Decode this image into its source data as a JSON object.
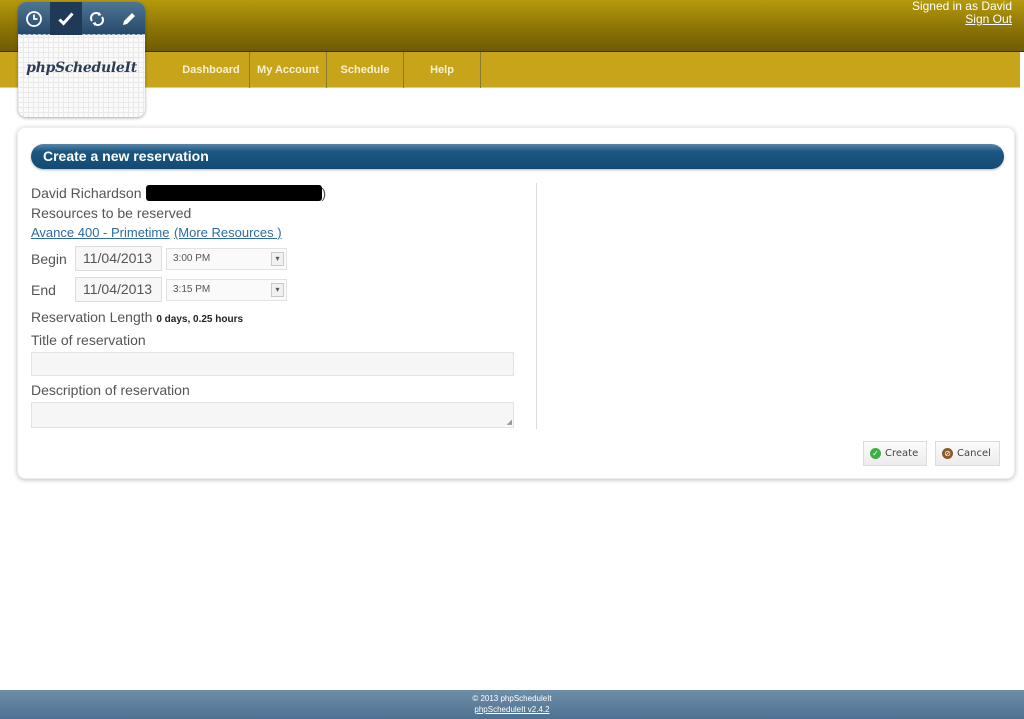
{
  "header": {
    "signed_in_text": "Signed in as David",
    "sign_out_label": "Sign Out"
  },
  "logo": {
    "text": "phpScheduleIt",
    "icons": [
      {
        "name": "clock-icon",
        "glyph": "◷"
      },
      {
        "name": "checkmark-icon",
        "glyph": "✔"
      },
      {
        "name": "refresh-icon",
        "glyph": "⟳"
      },
      {
        "name": "pencil-icon",
        "glyph": "✎"
      }
    ]
  },
  "nav": {
    "items": [
      {
        "label": "Dashboard"
      },
      {
        "label": "My Account"
      },
      {
        "label": "Schedule"
      },
      {
        "label": "Help"
      }
    ]
  },
  "reservation": {
    "title": "Create a new reservation",
    "user_name": "David Richardson",
    "user_paren_open": "(",
    "user_paren_close": ")",
    "resources_label": "Resources to be reserved",
    "resource_link": "Avance 400 - Primetime",
    "more_resources_link": "(More Resources )",
    "begin_label": "Begin",
    "begin_date": "11/04/2013",
    "begin_time": "3:00 PM",
    "end_label": "End",
    "end_date": "11/04/2013",
    "end_time": "3:15 PM",
    "length_label": "Reservation Length",
    "length_value": "0 days, 0.25 hours",
    "title_label": "Title of reservation",
    "title_value": "",
    "description_label": "Description of reservation",
    "description_value": "",
    "create_label": "Create",
    "cancel_label": "Cancel"
  },
  "colors": {
    "topbar": "#8c7406",
    "navbar": "#c8a41a",
    "header_bar": "#1b5782",
    "link": "#2e6b9e",
    "create_icon": "#3cb043",
    "cancel_icon": "#8a5a2b",
    "footer": "#5a7c9b"
  },
  "footer": {
    "copyright": "© 2013 phpScheduleIt",
    "version_link": "phpScheduleIt v2.4.2"
  }
}
